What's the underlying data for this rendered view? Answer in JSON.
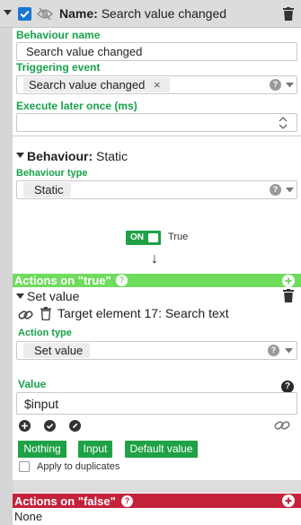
{
  "header": {
    "name_label": "Name:",
    "name_value": "Search value changed"
  },
  "behaviour_name": {
    "label": "Behaviour name",
    "value": "Search value changed"
  },
  "triggering_event": {
    "label": "Triggering event",
    "chip": "Search value changed",
    "remove_glyph": "×"
  },
  "execute_later": {
    "label": "Execute later once (ms)",
    "value": ""
  },
  "behaviour": {
    "label": "Behaviour:",
    "value": "Static",
    "type_label": "Behaviour type",
    "type_chip": "Static"
  },
  "toggle": {
    "state": "ON",
    "caption": "True"
  },
  "down_arrow": "↓",
  "actions_true": {
    "title": "Actions on \"true\"",
    "action_name": "Set value",
    "target": "Target element 17: Search text",
    "action_type_label": "Action type",
    "action_type_chip": "Set value",
    "value_label": "Value",
    "value": "$input",
    "buttons": [
      "Nothing",
      "Input",
      "Default value"
    ],
    "apply_label": "Apply to duplicates"
  },
  "actions_false": {
    "title": "Actions on \"false\"",
    "value": "None"
  },
  "colors": {
    "green_label": "#17a24a",
    "green_button": "#1fa146",
    "true_bar": "#6fdc5d",
    "false_bar": "#c4223a",
    "checkbox_blue": "#1976d2"
  },
  "icons": {
    "help": "?",
    "plus": "+",
    "close": "×"
  }
}
